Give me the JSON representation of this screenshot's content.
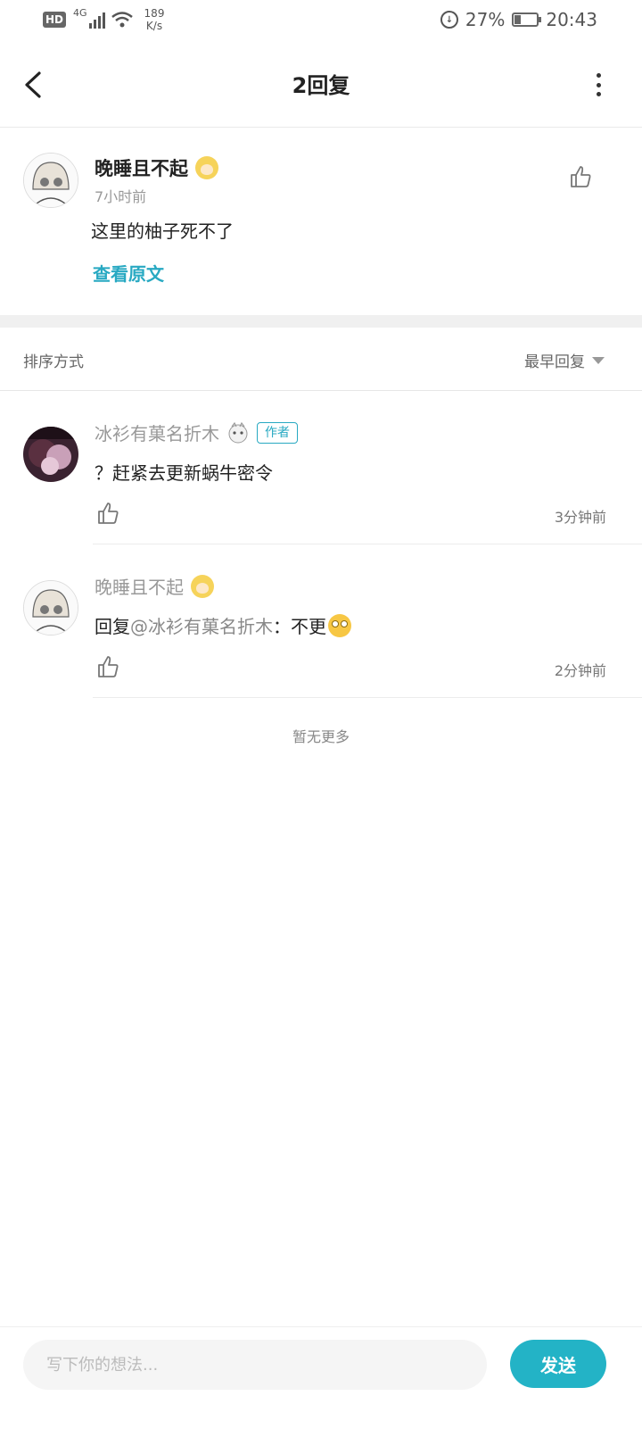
{
  "status_bar": {
    "hd": "HD",
    "network": "4G",
    "speed_value": "189",
    "speed_unit": "K/s",
    "battery_percent": "27%",
    "time": "20:43"
  },
  "nav": {
    "title": "2回复",
    "back_icon": "chevron-left-icon",
    "more_icon": "more-vertical-icon"
  },
  "post": {
    "username": "晚睡且不起",
    "time": "7小时前",
    "content": "这里的柚子死不了",
    "view_original": "查看原文"
  },
  "sort": {
    "label": "排序方式",
    "value": "最早回复"
  },
  "replies": [
    {
      "username": "冰衫有菓名折木",
      "author_tag": "作者",
      "content": "？赶紧去更新蜗牛密令",
      "time": "3分钟前"
    },
    {
      "username": "晚睡且不起",
      "reply_prefix": "回复",
      "mention": "@冰衫有菓名折木",
      "content": "：不更",
      "time": "2分钟前"
    }
  ],
  "no_more": "暂无更多",
  "composer": {
    "placeholder": "写下你的想法...",
    "send_label": "发送"
  },
  "colors": {
    "accent": "#28a9c2",
    "send_button": "#23b3c6"
  }
}
